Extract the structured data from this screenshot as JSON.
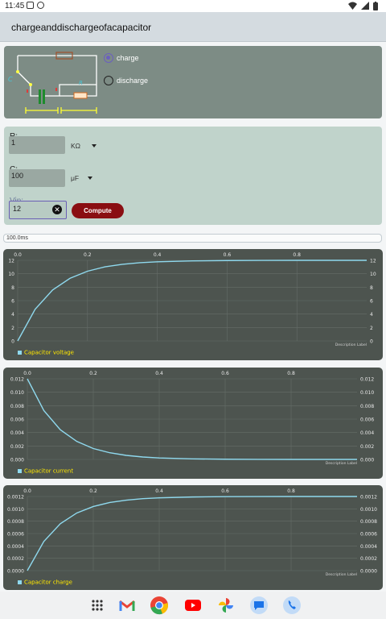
{
  "status": {
    "time": "11:45"
  },
  "app": {
    "title": "chargeanddischargeofacapacitor"
  },
  "mode": {
    "options": [
      {
        "label": "charge",
        "selected": true
      },
      {
        "label": "discharge",
        "selected": false
      }
    ]
  },
  "inputs": {
    "r": {
      "label": "R:",
      "value": "1",
      "unit": "KΩ"
    },
    "c": {
      "label": "C:",
      "value": "100",
      "unit": "μF"
    },
    "vin": {
      "label": "Vin:",
      "value": "12"
    }
  },
  "compute_label": "Compute",
  "progress": {
    "label": "100.0ms",
    "fraction": 1.0
  },
  "colors": {
    "series": "#8fd9ee",
    "legend_text": "#ffe800",
    "chart_bg": "#4d544f"
  },
  "chart_data": [
    {
      "type": "line",
      "series": [
        {
          "name": "Capacitor voltage",
          "x": [
            0,
            0.05,
            0.1,
            0.15,
            0.2,
            0.25,
            0.3,
            0.35,
            0.4,
            0.5,
            0.6,
            0.7,
            0.8,
            0.9,
            1.0
          ],
          "values": [
            0,
            4.72,
            7.59,
            9.33,
            10.38,
            11.03,
            11.41,
            11.65,
            11.78,
            11.92,
            11.97,
            11.99,
            12.0,
            12.0,
            12.0
          ]
        }
      ],
      "x_ticks": [
        "0.0",
        "0.2",
        "0.4",
        "0.6",
        "0.8"
      ],
      "y_ticks": [
        "0",
        "2",
        "4",
        "6",
        "8",
        "10",
        "12"
      ],
      "xlim": [
        0,
        1.0
      ],
      "ylim": [
        0,
        12
      ],
      "description": "Description Label"
    },
    {
      "type": "line",
      "series": [
        {
          "name": "Capacitor current",
          "x": [
            0,
            0.05,
            0.1,
            0.15,
            0.2,
            0.25,
            0.3,
            0.35,
            0.4,
            0.5,
            0.6,
            0.7,
            0.8,
            0.9,
            1.0
          ],
          "values": [
            0.012,
            0.00728,
            0.00441,
            0.00268,
            0.00162,
            0.00099,
            0.0006,
            0.00036,
            0.00022,
            8e-05,
            3e-05,
            1e-05,
            0,
            0,
            0
          ]
        }
      ],
      "x_ticks": [
        "0.0",
        "0.2",
        "0.4",
        "0.6",
        "0.8"
      ],
      "y_ticks": [
        "0.000",
        "0.002",
        "0.004",
        "0.006",
        "0.008",
        "0.010",
        "0.012"
      ],
      "xlim": [
        0,
        1.0
      ],
      "ylim": [
        0,
        0.012
      ],
      "description": "Description Label"
    },
    {
      "type": "line",
      "series": [
        {
          "name": "Capacitor charge",
          "x": [
            0,
            0.05,
            0.1,
            0.15,
            0.2,
            0.25,
            0.3,
            0.35,
            0.4,
            0.5,
            0.6,
            0.7,
            0.8,
            0.9,
            1.0
          ],
          "values": [
            0,
            0.000472,
            0.000759,
            0.000933,
            0.001038,
            0.001103,
            0.001141,
            0.001165,
            0.001178,
            0.001192,
            0.001197,
            0.001199,
            0.0012,
            0.0012,
            0.0012
          ]
        }
      ],
      "x_ticks": [
        "0.0",
        "0.2",
        "0.4",
        "0.6",
        "0.8"
      ],
      "y_ticks": [
        "0.0000",
        "0.0002",
        "0.0004",
        "0.0006",
        "0.0008",
        "0.0010",
        "0.0012"
      ],
      "xlim": [
        0,
        1.0
      ],
      "ylim": [
        0,
        0.0012
      ],
      "description": "Description Label"
    }
  ],
  "dock": {
    "apps": [
      "apps-grid-icon",
      "gmail-icon",
      "chrome-icon",
      "youtube-icon",
      "photos-icon",
      "messages-icon",
      "phone-icon"
    ]
  }
}
